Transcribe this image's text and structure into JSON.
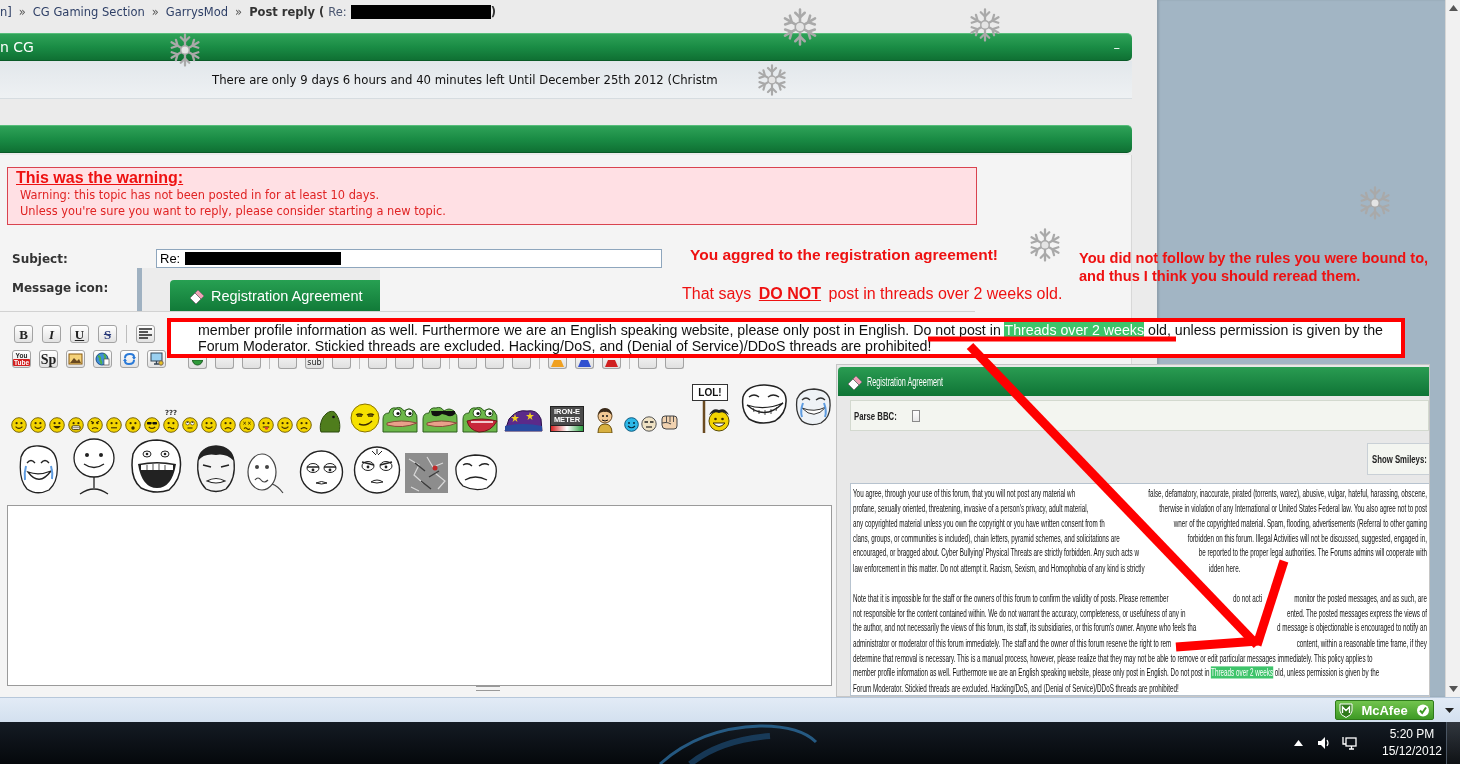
{
  "breadcrumb": {
    "items": [
      "n]",
      "CG Gaming Section",
      "GarrysMod"
    ],
    "separator": "»",
    "current": "Post reply (",
    "subject_prefix": "Re:",
    "subject_redacted": true,
    "closing": ")"
  },
  "board_header": {
    "title": "n CG",
    "toggle": "–"
  },
  "countdown": {
    "text": "There are only 9 days 6 hours and 40 minutes left Until December 25th 2012 (Christm"
  },
  "warning": {
    "title": "This was the warning:",
    "lines": [
      "Warning: this topic has not been posted in for at least 10 days.",
      "Unless you're sure you want to reply, please consider starting a new topic."
    ]
  },
  "form": {
    "subject": {
      "label": "Subject:",
      "value": "Re:",
      "redacted": true
    },
    "message_icon": {
      "label": "Message icon:"
    }
  },
  "pasted_tab": {
    "title": "Registration Agreement"
  },
  "annotations": [
    {
      "kind": "headline",
      "text": "You aggred to the registration agreement!"
    },
    {
      "kind": "note",
      "text": "That says **DO NOT** post in threads over 2 weeks old."
    },
    {
      "kind": "aside",
      "text": "You did not follow by the rules you were bound to, and thus I think you should reread them."
    }
  ],
  "toolbar": {
    "rows": [
      [
        {
          "kind": "bold",
          "label": "B"
        },
        {
          "kind": "italic",
          "label": "I"
        },
        {
          "kind": "underline",
          "label": "U"
        },
        {
          "kind": "strike",
          "label": "S"
        },
        {
          "kind": "separator"
        },
        {
          "kind": "align-left"
        }
      ],
      [
        {
          "kind": "youtube",
          "lines": [
            "You",
            "Tube"
          ]
        },
        {
          "kind": "spoiler",
          "label": "Sp"
        },
        {
          "kind": "image"
        },
        {
          "kind": "globe"
        },
        {
          "kind": "swap"
        },
        {
          "kind": "network"
        }
      ]
    ],
    "hidden_buttons": [
      {
        "kind": "round"
      },
      {
        "kind": "plain"
      },
      {
        "kind": "plain"
      },
      {
        "kind": "separator"
      },
      {
        "kind": "plain"
      },
      {
        "kind": "text",
        "label": "sub"
      },
      {
        "kind": "plain"
      },
      {
        "kind": "separator"
      },
      {
        "kind": "plain"
      },
      {
        "kind": "plain"
      },
      {
        "kind": "plain"
      },
      {
        "kind": "separator"
      },
      {
        "kind": "plain"
      },
      {
        "kind": "plain"
      },
      {
        "kind": "plain"
      },
      {
        "kind": "separator"
      },
      {
        "kind": "triangle",
        "color": "#f0a020"
      },
      {
        "kind": "triangle",
        "color": "#3050d0"
      },
      {
        "kind": "triangle",
        "color": "#d02020"
      },
      {
        "kind": "separator"
      },
      {
        "kind": "plain"
      },
      {
        "kind": "plain"
      }
    ]
  },
  "smileys": [
    {
      "kind": "smile"
    },
    {
      "kind": "smile"
    },
    {
      "kind": "grin"
    },
    {
      "kind": "teeth"
    },
    {
      "kind": "angry"
    },
    {
      "kind": "neutral"
    },
    {
      "kind": "shocked"
    },
    {
      "kind": "cool"
    },
    {
      "kind": "confused",
      "label": "???"
    },
    {
      "kind": "rolleyes"
    },
    {
      "kind": "smile"
    },
    {
      "kind": "sad"
    },
    {
      "kind": "dizzy"
    },
    {
      "kind": "tongue"
    },
    {
      "kind": "smile"
    },
    {
      "kind": "sad"
    },
    {
      "kind": "blob"
    },
    {
      "kind": "smug"
    },
    {
      "kind": "frog"
    },
    {
      "kind": "frog-shades"
    },
    {
      "kind": "frog-shout"
    },
    {
      "kind": "wizard"
    },
    {
      "kind": "meter",
      "label": "IRON-E METER"
    },
    {
      "kind": "man"
    },
    {
      "kind": "blue"
    },
    {
      "kind": "squint"
    },
    {
      "kind": "fist"
    },
    {
      "kind": "sign",
      "label": "LOL!"
    },
    {
      "kind": "troll"
    },
    {
      "kind": "troll-cry"
    }
  ],
  "rage_faces": [
    {
      "kind": "happy-cry"
    },
    {
      "kind": "forever-alone"
    },
    {
      "kind": "laugh"
    },
    {
      "kind": "disappointed"
    },
    {
      "kind": "scribble"
    },
    {
      "kind": "me-gusta"
    },
    {
      "kind": "angry-gusta"
    },
    {
      "kind": "crumpled"
    },
    {
      "kind": "troll-sad"
    }
  ],
  "callout": {
    "segments": [
      {
        "text": "member profile information as well. Furthermore we are an English speaking website, please only post in English. Do not post in ",
        "highlighted": false
      },
      {
        "text": "Threads over 2 weeks",
        "highlighted": true
      },
      {
        "text": " old, unless permission is given by the Forum Moderator. Stickied threads are excluded. Hacking/DoS, and (Denial of Service)/DDoS threads are prohibited!",
        "highlighted": false
      }
    ]
  },
  "inset": {
    "title": "Registration Agreement",
    "parse_bbc": {
      "label": "Parse BBC:",
      "checked": false
    },
    "show_smileys": {
      "label": "Show Smileys:"
    },
    "paragraphs": [
      {
        "lines": [
          {
            "parts": [
              {
                "text": "You agree, through your use of this forum, that you will not post any material wh"
              },
              {
                "text": "false, defamatory, inaccurate, pirated (torrents, warez), abusive, vulgar, hateful, harassing, obscene,"
              }
            ]
          },
          {
            "parts": [
              {
                "text": "profane, sexually oriented, threatening, invasive of a person's privacy, adult material,"
              },
              {
                "text": "therwise in violation of any International or United States Federal law. You also agree not to post"
              }
            ]
          },
          {
            "parts": [
              {
                "text": "any copyrighted material unless you own the copyright or you have written consent from th"
              },
              {
                "text": "wner of the copyrighted material. Spam, flooding, advertisements (Referral to other gaming"
              }
            ]
          },
          {
            "parts": [
              {
                "text": "clans, groups, or communities is included), chain letters, pyramid schemes, and solicitations are"
              },
              {
                "text": "forbidden on this forum. Illegal Activities will not be discussed, suggested, engaged in,"
              }
            ]
          },
          {
            "parts": [
              {
                "text": "encouraged, or bragged about. Cyber Bullying/ Physical Threats are strictly forbidden. Any such acts w"
              },
              {
                "text": "be reported to the proper legal authorities. The Forums admins will cooperate with"
              }
            ]
          },
          {
            "parts": [
              {
                "text": "law enforcement in this matter. Do not attempt it. Racism, Sexism, and Homophobia of any kind is strictly"
              },
              {
                "text": "idden here."
              }
            ]
          }
        ]
      },
      {
        "lines": [
          {
            "parts": [
              {
                "text": "Note that it is impossible for the staff or the owners of this forum to confirm the validity of posts. Please remember"
              },
              {
                "text": "do not acti"
              },
              {
                "text": "monitor the posted messages, and as such, are"
              }
            ]
          },
          {
            "parts": [
              {
                "text": "not responsible for the content contained within. We do not warrant the accuracy, completeness, or usefulness of any in"
              },
              {
                "text": "ented. The posted messages express the views of"
              }
            ]
          },
          {
            "parts": [
              {
                "text": "the author, and not necessarily the views of this forum, its staff, its subsidiaries, or this forum's owner. Anyone who feels tha"
              },
              {
                "text": "d message is objectionable is encouraged to notify an"
              }
            ]
          },
          {
            "parts": [
              {
                "text": "administrator or moderator of this forum immediately. The staff and the owner of this forum reserve the right to rem"
              },
              {
                "text": "content, within a reasonable time frame, if they"
              }
            ]
          },
          {
            "parts": [
              {
                "text": "determine that removal is necessary. This is a manual process, however, please realize that they may not be able to remove or edit particular messages immediately. This policy applies to"
              }
            ]
          },
          {
            "parts": [
              {
                "segments": [
                  {
                    "text": "member profile information as well. Furthermore we are an English speaking website, please only post in English. Do not post in ",
                    "highlighted": false
                  },
                  {
                    "text": "Threads over 2 weeks",
                    "highlighted": true
                  },
                  {
                    "text": " old, unless permission is given by the",
                    "highlighted": false
                  }
                ]
              }
            ]
          },
          {
            "parts": [
              {
                "text": "Forum Moderator. Stickied threads are excluded. Hacking/DoS, and (Denial of Service)/DDoS threads are prohibited!"
              }
            ]
          }
        ]
      }
    ]
  },
  "status_bar": {
    "badge": "McAfee"
  },
  "taskbar": {
    "time": "5:20 PM",
    "date": "15/12/2012"
  }
}
